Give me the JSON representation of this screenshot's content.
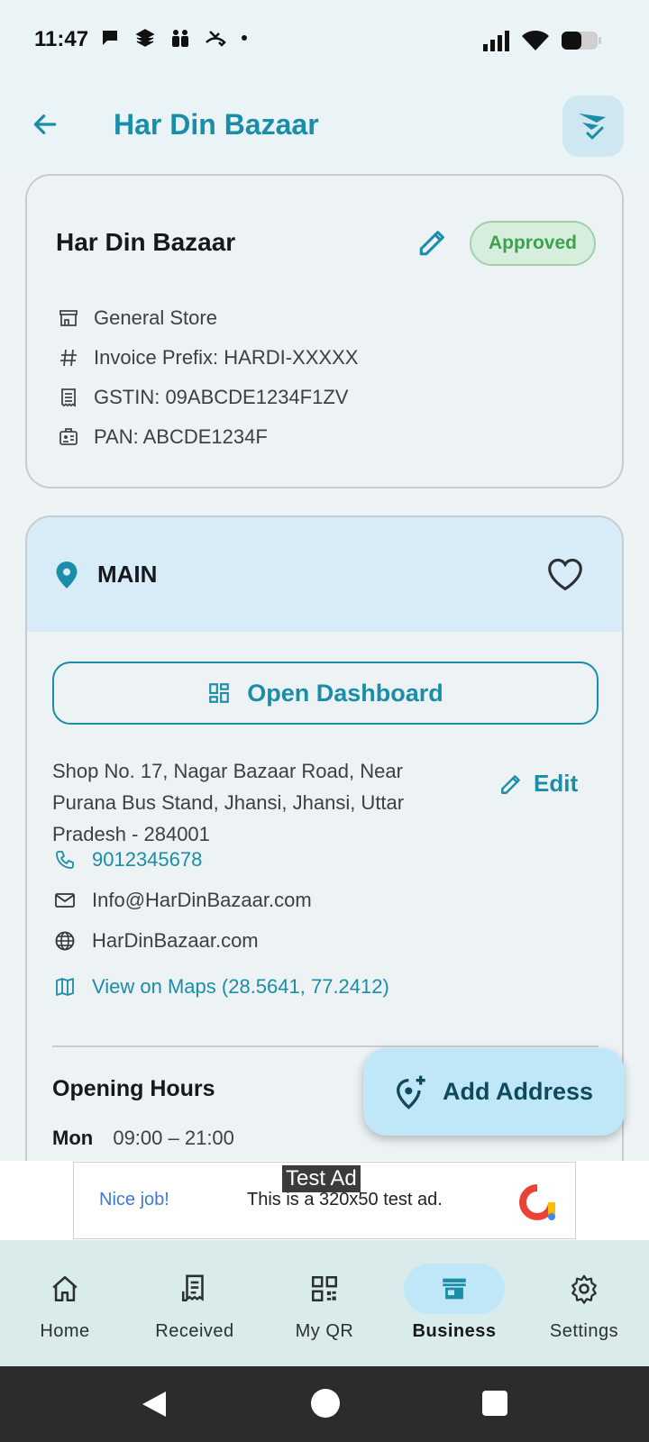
{
  "status_bar": {
    "time": "11:47",
    "left_icons": [
      "chat-bubble-icon",
      "layers-icon",
      "people-icon",
      "missed-call-icon",
      "dot-icon"
    ],
    "right_icons": [
      "signal-icon",
      "wifi-icon",
      "battery-icon"
    ]
  },
  "app_bar": {
    "title": "Har Din Bazaar",
    "back_icon": "arrow-back-icon",
    "action_icon": "send-check-icon"
  },
  "business_card": {
    "name": "Har Din Bazaar",
    "status": "Approved",
    "category": "General Store",
    "invoice_prefix": "Invoice Prefix: HARDI-XXXXX",
    "gstin": "GSTIN: 09ABCDE1234F1ZV",
    "pan": "PAN: ABCDE1234F"
  },
  "location_card": {
    "name": "MAIN",
    "open_dashboard_label": "Open Dashboard",
    "address": "Shop No. 17, Nagar Bazaar Road, Near Purana Bus Stand, Jhansi, Jhansi, Uttar Pradesh - 284001",
    "edit_label": "Edit",
    "phone": "9012345678",
    "email": "Info@HarDinBazaar.com",
    "website": "HarDinBazaar.com",
    "maps_link": "View on Maps (28.5641, 77.2412)",
    "opening_hours_title": "Opening Hours",
    "hours": [
      {
        "day": "Mon",
        "time": "09:00 – 21:00"
      }
    ]
  },
  "fab": {
    "label": "Add Address"
  },
  "ad": {
    "label": "Test Ad",
    "nice": "Nice job!",
    "text": "This is a 320x50 test ad."
  },
  "bottom_nav": {
    "items": [
      {
        "label": "Home",
        "icon": "home-icon"
      },
      {
        "label": "Received",
        "icon": "receipt-icon"
      },
      {
        "label": "My QR",
        "icon": "qr-code-icon"
      },
      {
        "label": "Business",
        "icon": "store-icon",
        "active": true
      },
      {
        "label": "Settings",
        "icon": "gear-icon"
      }
    ]
  },
  "colors": {
    "accent": "#1a8da8",
    "approved_green": "#3da24f",
    "header_bg": "#eaf4f6",
    "location_header_bg": "#d8ecf7",
    "fab_bg": "#bfe7f8"
  }
}
